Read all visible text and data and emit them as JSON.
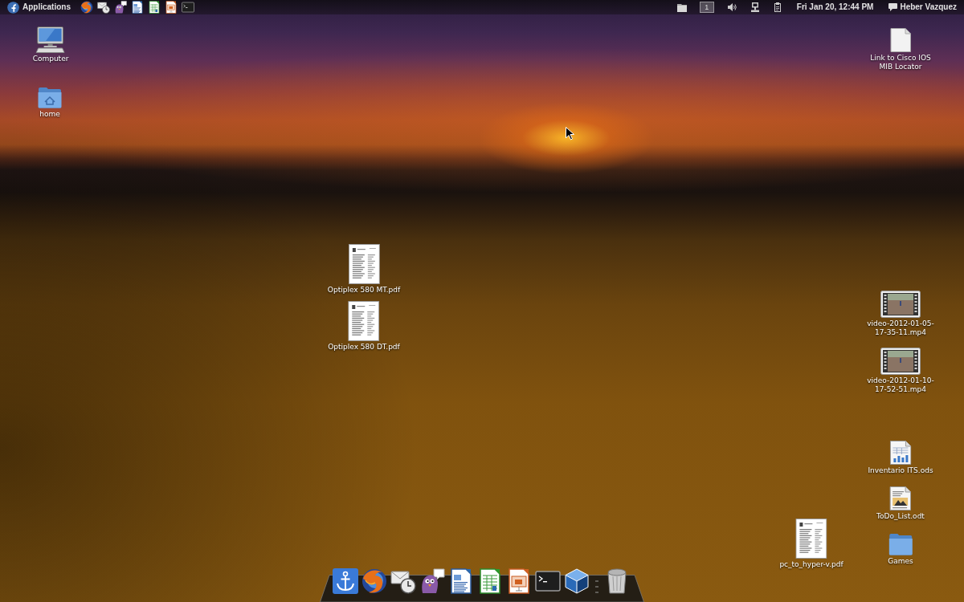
{
  "top_panel": {
    "menu_label": "Applications",
    "launchers": [
      {
        "kind": "browser"
      },
      {
        "kind": "mail"
      },
      {
        "kind": "chat"
      },
      {
        "kind": "writer"
      },
      {
        "kind": "spreadsheet"
      },
      {
        "kind": "presentation"
      },
      {
        "kind": "terminal"
      }
    ],
    "workspace": {
      "label": "1",
      "selected": true
    },
    "clock": "Fri Jan 20, 12:44 PM",
    "user": "Heber Vazquez"
  },
  "desktop_icons": [
    {
      "kind": "computer",
      "label": "Computer"
    },
    {
      "kind": "blank",
      "label": "Link to Cisco IOS MIB Locator"
    },
    {
      "kind": "home",
      "label": "home"
    },
    {
      "kind": "pdf",
      "label": "Optiplex 580 MT.pdf"
    },
    {
      "kind": "video",
      "label": "video-2012-01-05-17-35-11.mp4"
    },
    {
      "kind": "pdf",
      "label": "Optiplex 580 DT.pdf"
    },
    {
      "kind": "video",
      "label": "video-2012-01-10-17-52-51.mp4"
    },
    {
      "kind": "spreadsheet",
      "label": "Inventario ITS.ods"
    },
    {
      "kind": "document",
      "label": "ToDo_List.odt"
    },
    {
      "kind": "pdf",
      "label": "pc_to_hyper-v.pdf"
    },
    {
      "kind": "folder",
      "label": "Games"
    }
  ],
  "dock": {
    "items": [
      {
        "kind": "anchor"
      },
      {
        "kind": "browser"
      },
      {
        "kind": "mail"
      },
      {
        "kind": "chat"
      },
      {
        "kind": "writer"
      },
      {
        "kind": "spreadsheet"
      },
      {
        "kind": "presentation"
      },
      {
        "kind": "terminal"
      },
      {
        "kind": "virtualbox"
      },
      {
        "kind": "separator"
      },
      {
        "kind": "trash"
      }
    ]
  }
}
